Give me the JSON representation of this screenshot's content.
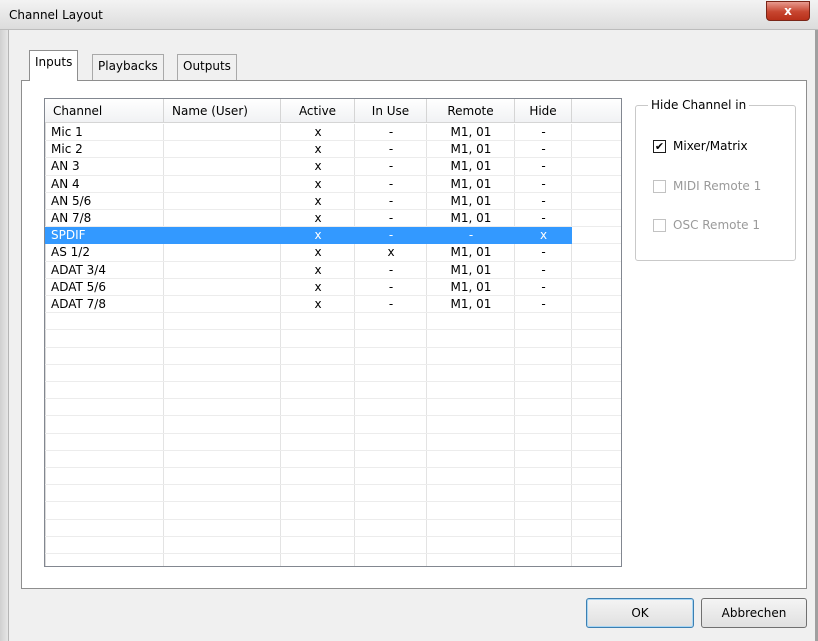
{
  "window": {
    "title": "Channel Layout",
    "close_glyph": "x"
  },
  "tabs": [
    {
      "label": "Inputs",
      "active": true
    },
    {
      "label": "Playbacks",
      "active": false
    },
    {
      "label": "Outputs",
      "active": false
    }
  ],
  "table": {
    "columns": [
      "Channel",
      "Name (User)",
      "Active",
      "In Use",
      "Remote",
      "Hide"
    ],
    "rows": [
      {
        "channel": "Mic 1",
        "name": "",
        "active": "x",
        "in_use": "-",
        "remote": "M1, 01",
        "hide": "-"
      },
      {
        "channel": "Mic 2",
        "name": "",
        "active": "x",
        "in_use": "-",
        "remote": "M1, 01",
        "hide": "-"
      },
      {
        "channel": "AN 3",
        "name": "",
        "active": "x",
        "in_use": "-",
        "remote": "M1, 01",
        "hide": "-"
      },
      {
        "channel": "AN 4",
        "name": "",
        "active": "x",
        "in_use": "-",
        "remote": "M1, 01",
        "hide": "-"
      },
      {
        "channel": "AN 5/6",
        "name": "",
        "active": "x",
        "in_use": "-",
        "remote": "M1, 01",
        "hide": "-"
      },
      {
        "channel": "AN 7/8",
        "name": "",
        "active": "x",
        "in_use": "-",
        "remote": "M1, 01",
        "hide": "-"
      },
      {
        "channel": "SPDIF",
        "name": "",
        "active": "x",
        "in_use": "-",
        "remote": "-",
        "hide": "x",
        "selected": true
      },
      {
        "channel": "AS 1/2",
        "name": "",
        "active": "x",
        "in_use": "x",
        "remote": "M1, 01",
        "hide": "-"
      },
      {
        "channel": "ADAT 3/4",
        "name": "",
        "active": "x",
        "in_use": "-",
        "remote": "M1, 01",
        "hide": "-"
      },
      {
        "channel": "ADAT 5/6",
        "name": "",
        "active": "x",
        "in_use": "-",
        "remote": "M1, 01",
        "hide": "-"
      },
      {
        "channel": "ADAT 7/8",
        "name": "",
        "active": "x",
        "in_use": "-",
        "remote": "M1, 01",
        "hide": "-"
      }
    ],
    "selected_color": "#3399ff"
  },
  "hide_group": {
    "title": "Hide Channel in",
    "options": [
      {
        "label": "Mixer/Matrix",
        "checked": true,
        "enabled": true
      },
      {
        "label": "MIDI Remote 1",
        "checked": false,
        "enabled": false
      },
      {
        "label": "OSC Remote 1",
        "checked": false,
        "enabled": false
      }
    ]
  },
  "buttons": {
    "ok": "OK",
    "cancel": "Abbrechen"
  },
  "colors": {
    "close_button": "#c7452f",
    "selection": "#3399ff",
    "disabled_text": "#9a9a9a"
  }
}
